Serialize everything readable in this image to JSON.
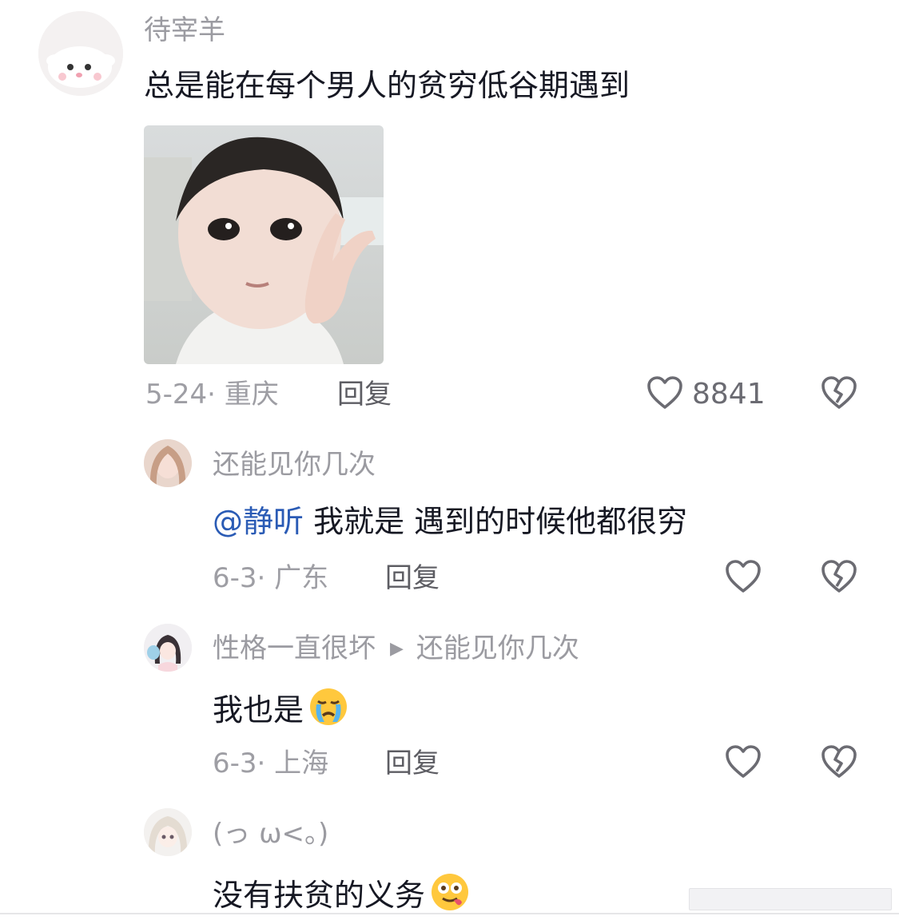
{
  "comments": [
    {
      "username": "待宰羊",
      "text": "总是能在每个男人的贫穷低谷期遇到",
      "date": "5-24",
      "location": "重庆",
      "reply_label": "回复",
      "likes": "8841"
    }
  ],
  "replies": [
    {
      "username": "还能见你几次",
      "mention": "@静听",
      "text": " 我就是 遇到的时候他都很穷",
      "date": "6-3",
      "location": "广东",
      "reply_label": "回复"
    },
    {
      "username": "性格一直很坏",
      "reply_to": "还能见你几次",
      "text": "我也是",
      "emoji": "crying-face-emoji",
      "date": "6-3",
      "location": "上海",
      "reply_label": "回复"
    },
    {
      "username": "(っ ω<。)",
      "text": "没有扶贫的义务",
      "emoji": "woozy-tongue-emoji"
    }
  ],
  "icons": {
    "like": "heart-outline-icon",
    "dislike": "broken-heart-icon",
    "reply_arrow": "triangle-right-icon"
  },
  "colors": {
    "mention": "#2a5bb5",
    "username": "#9b9ba1",
    "text": "#161823"
  }
}
